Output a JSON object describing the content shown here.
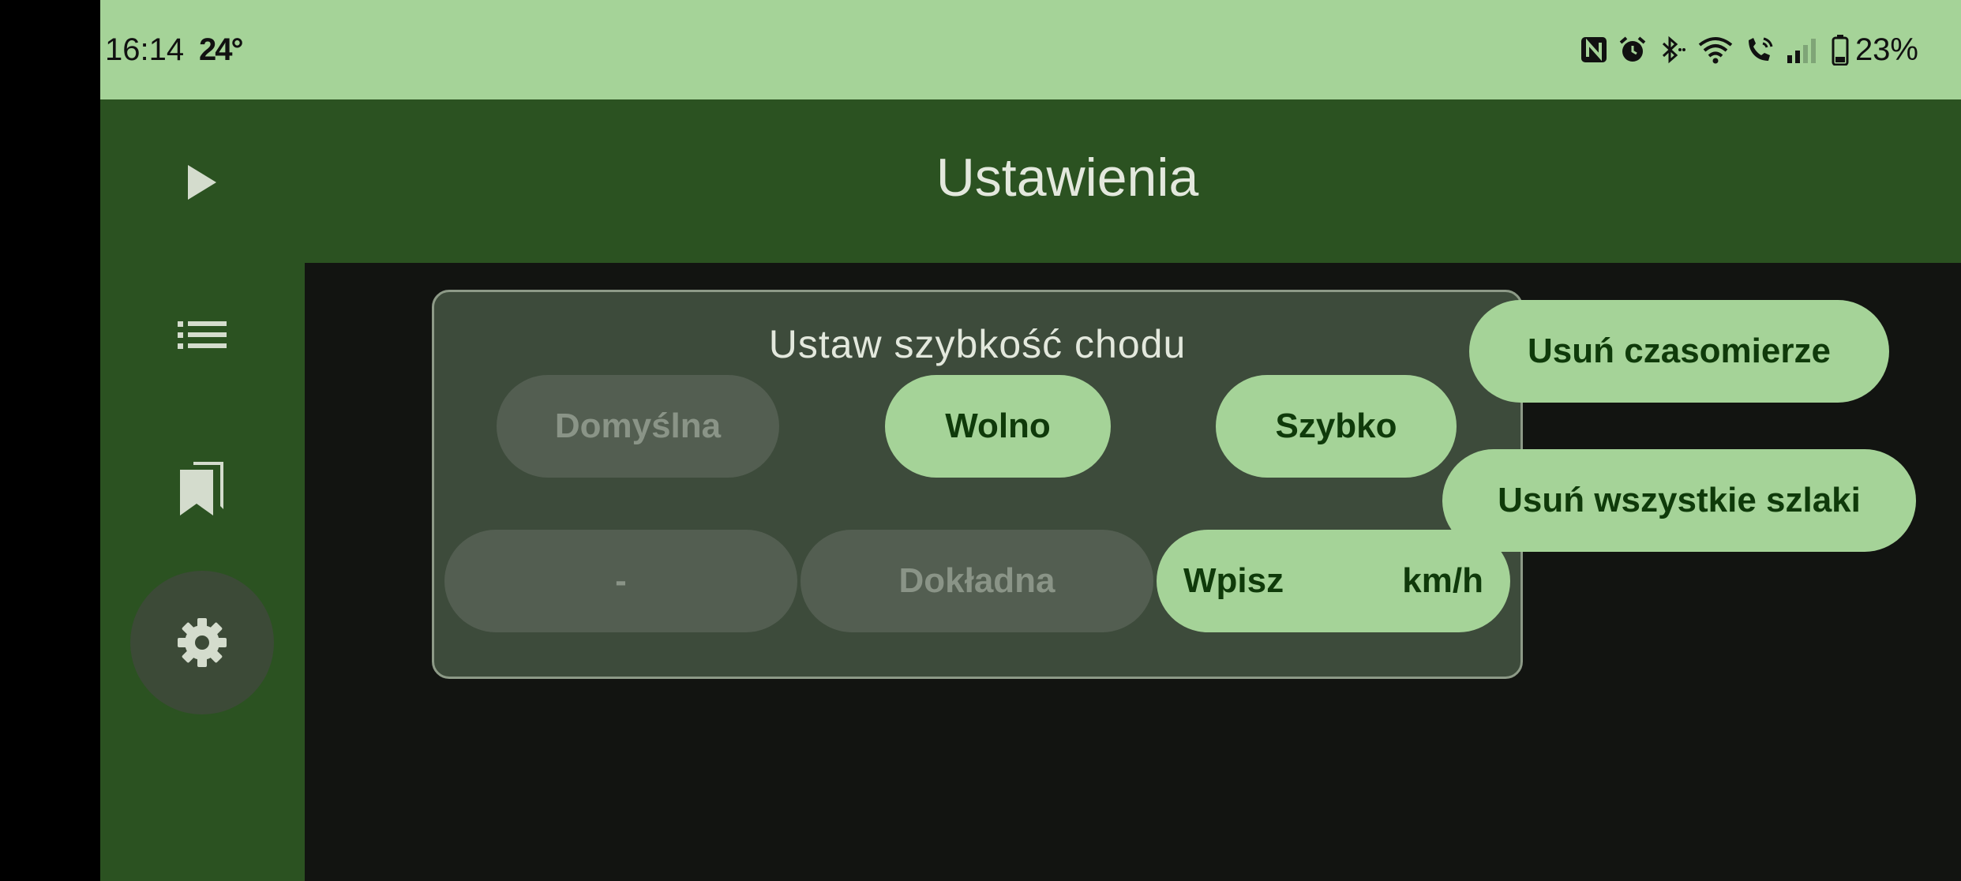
{
  "status_bar": {
    "time": "16:14",
    "temperature": "24°",
    "battery_percent": "23%",
    "icons": [
      "nfc-icon",
      "alarm-icon",
      "bluetooth-icon",
      "wifi-icon",
      "wifi-calling-icon",
      "signal-icon",
      "battery-icon"
    ]
  },
  "app_bar": {
    "title": "Ustawienia"
  },
  "nav_rail": {
    "items": [
      {
        "icon": "play-icon",
        "active": false
      },
      {
        "icon": "list-icon",
        "active": false
      },
      {
        "icon": "bookmarks-icon",
        "active": false
      },
      {
        "icon": "gear-icon",
        "active": true
      }
    ]
  },
  "speed_card": {
    "title": "Ustaw szybkość chodu",
    "presets": {
      "default_label": "Domyślna",
      "slow_label": "Wolno",
      "fast_label": "Szybko"
    },
    "custom": {
      "value": "-",
      "precise_label": "Dokładna",
      "input_label": "Wpisz",
      "unit_label": "km/h"
    }
  },
  "actions": {
    "clear_timers_label": "Usuń czasomierze",
    "clear_trails_label": "Usuń wszystkie szlaki"
  },
  "colors": {
    "status_bar": "#a5d398",
    "nav_background": "#2b5221",
    "content_background": "#121411",
    "card_background": "#3d4b3b",
    "button_fill": "#a5d398",
    "button_text": "#0f3a0a",
    "disabled_fill": "#535e51"
  }
}
